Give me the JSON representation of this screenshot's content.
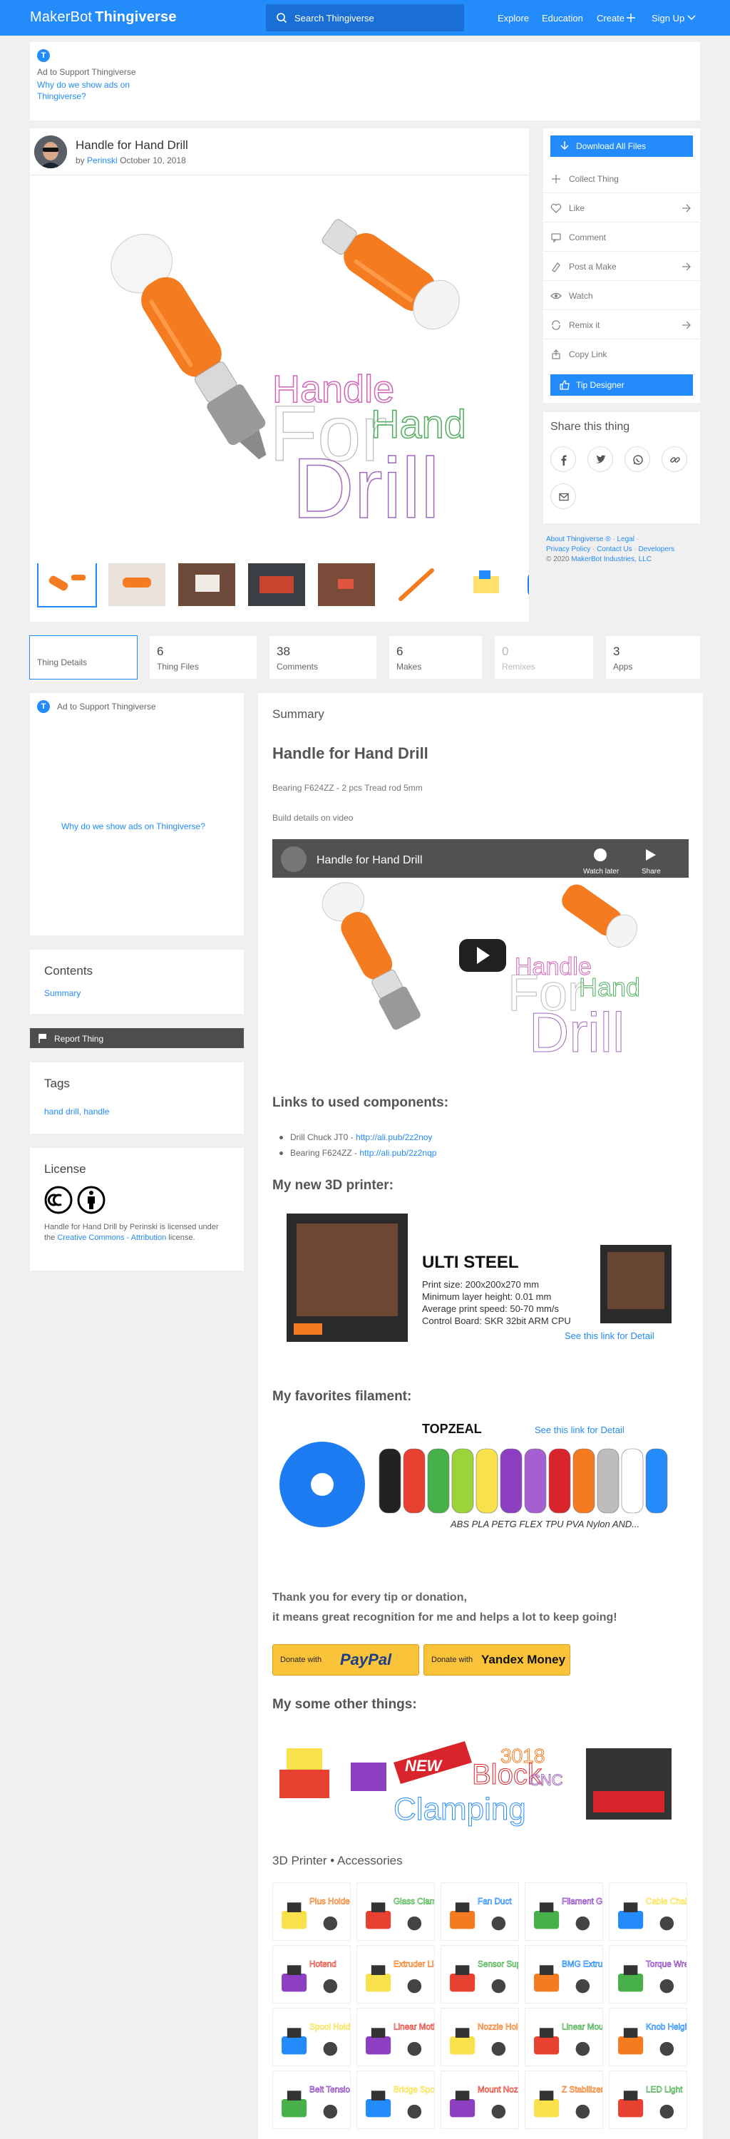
{
  "header": {
    "logo_main": "MakerBot",
    "logo_sub": "Thingiverse",
    "search_placeholder": "Search Thingiverse",
    "nav": [
      "Explore",
      "Education",
      "Create",
      "Sign Up"
    ]
  },
  "ad_top": {
    "badge": "T",
    "text": "Ad to Support Thingiverse",
    "link": "Why do we show ads on Thingiverse?"
  },
  "thing": {
    "title": "Handle for Hand Drill",
    "by": "by",
    "author": "Perinski",
    "date": "October 10, 2018",
    "hero_text": [
      "Handle",
      "For",
      "Hand",
      "Drill"
    ]
  },
  "actions": {
    "download": "Download All Files",
    "items": [
      "Collect Thing",
      "Like",
      "Comment",
      "Post a Make",
      "Watch",
      "Remix it",
      "Copy Link"
    ],
    "tip": "Tip Designer"
  },
  "share": {
    "title": "Share this thing"
  },
  "footer_links": {
    "line1": [
      "About Thingiverse ®",
      "Legal"
    ],
    "line2": [
      "Privacy Policy",
      "Contact Us",
      "Developers"
    ],
    "copyright": "© 2020",
    "company": "MakerBot Industries, LLC"
  },
  "tabs": [
    {
      "count": "",
      "label": "Thing Details"
    },
    {
      "count": "6",
      "label": "Thing Files"
    },
    {
      "count": "38",
      "label": "Comments"
    },
    {
      "count": "6",
      "label": "Makes"
    },
    {
      "count": "0",
      "label": "Remixes"
    },
    {
      "count": "3",
      "label": "Apps"
    }
  ],
  "left": {
    "ad_text": "Ad to Support Thingiverse",
    "ad_link": "Why do we show ads on Thingiverse?",
    "contents_title": "Contents",
    "contents_item": "Summary",
    "report": "Report Thing",
    "tags_title": "Tags",
    "tags": "hand drill, handle",
    "license_title": "License",
    "license_text_1": "Handle for Hand Drill by Perinski is licensed under the",
    "license_link": "Creative Commons - Attribution",
    "license_text_2": "license."
  },
  "summary": {
    "label": "Summary",
    "title": "Handle for Hand Drill",
    "line1": "Bearing F624ZZ - 2 pcs Tread rod 5mm",
    "line2": "Build details on video",
    "video_title": "Handle for Hand Drill",
    "video_watch_later": "Watch later",
    "video_share": "Share",
    "links_heading": "Links to used components:",
    "components": [
      {
        "name": "Drill Chuck JT0 - ",
        "url": "http://ali.pub/2z2noy"
      },
      {
        "name": "Bearing F624ZZ - ",
        "url": "http://ali.pub/2z2nqp"
      }
    ],
    "printer_heading": "My new 3D printer:",
    "printer_brand": "ULTI STEEL",
    "printer_specs": [
      "Print size: 200x200x270 mm",
      "Minimum layer height: 0.01 mm",
      "Average print speed: 50-70 mm/s",
      "Control Board: SKR 32bit ARM CPU"
    ],
    "printer_link": "See this link for Detail",
    "filament_heading": "My favorites filament:",
    "filament_brand": "TOPZEAL",
    "filament_link": "See this link for Detail",
    "filament_types": "ABS PLA PETG FLEX TPU PVA Nylon AND...",
    "thanks_1": "Thank you for every tip or donation,",
    "thanks_2": "it means great recognition for me and helps a lot to keep going!",
    "donate_with": "Donate with",
    "paypal": "PayPal",
    "yandex": "Yandex Money",
    "other_heading": "My some other things:",
    "other_banner": [
      "NEW",
      "Block",
      "Clamping",
      "3018",
      "CNC"
    ],
    "accessories_heading": "3D Printer • Accessories",
    "tile_labels": [
      "Plus Holder",
      "Glass Clamp",
      "Fan Duct",
      "Filament Guide",
      "Cable Chain",
      "Hotend",
      "Extruder Light",
      "Sensor Support",
      "BMG Extruder",
      "Torque Wrench",
      "Spool Holder",
      "Linear Motion",
      "Nozzle Holder",
      "Linear Mount",
      "Knob Height",
      "Belt Tensioner",
      "Bridge Spool",
      "Mount Nozzle",
      "Z Stabilizer",
      "LED Light"
    ]
  },
  "colors": {
    "brand": "#248bfb",
    "orange": "#f47b20",
    "paypal": "#fbc33a"
  }
}
